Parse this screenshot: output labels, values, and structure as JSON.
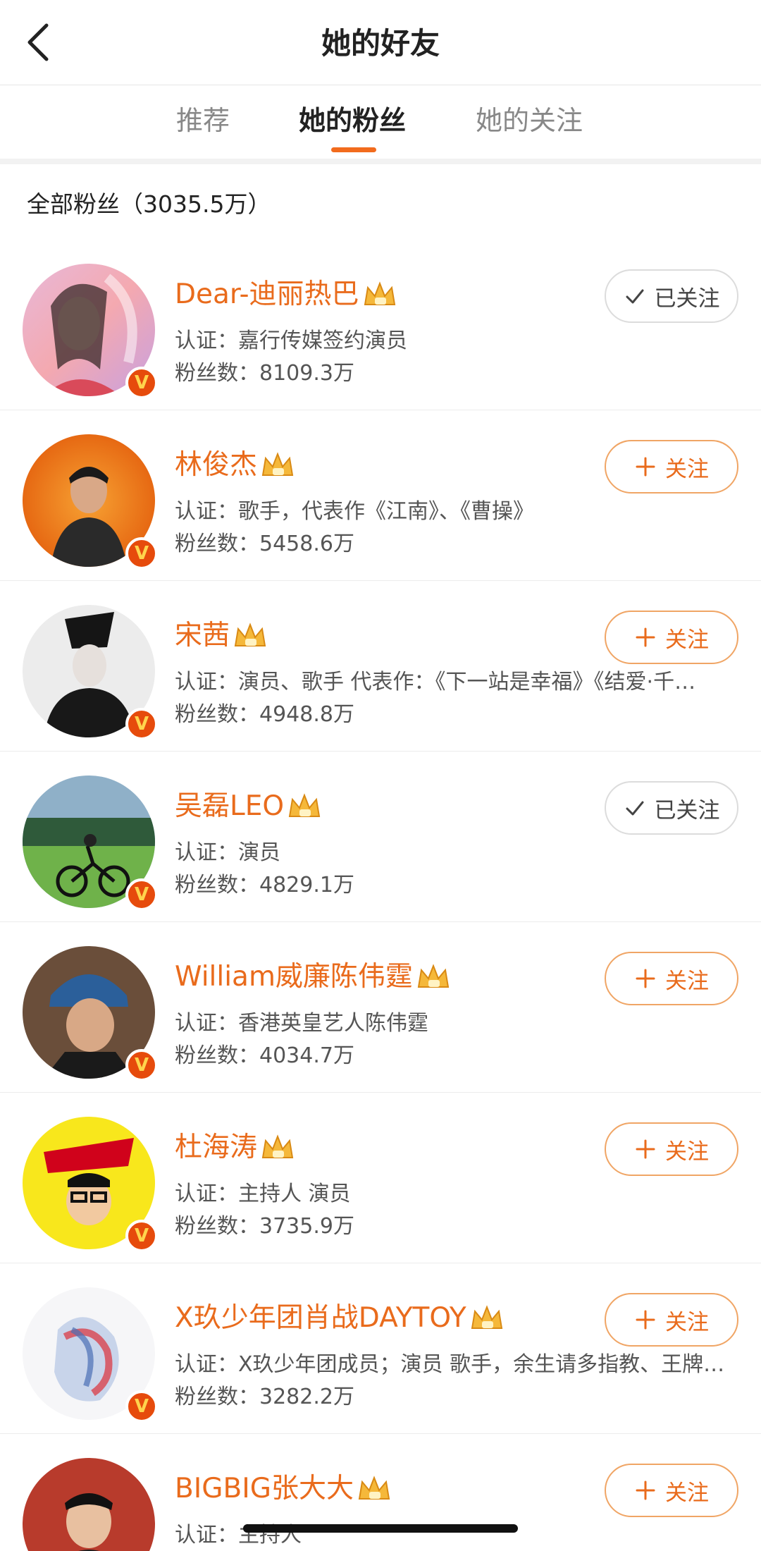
{
  "header": {
    "title": "她的好友"
  },
  "tabs": [
    {
      "label": "推荐"
    },
    {
      "label": "她的粉丝",
      "active": true
    },
    {
      "label": "她的关注"
    }
  ],
  "section": {
    "title": "全部粉丝（3035.5万）"
  },
  "colors": {
    "accent": "#e96b1c",
    "indicator": "#f26b1d",
    "verified_badge": "#e64b0c"
  },
  "users": [
    {
      "name": "Dear-迪丽热巴",
      "info": "认证：嘉行传媒签约演员",
      "fans": "粉丝数：8109.3万",
      "button": "已关注",
      "followed": true
    },
    {
      "name": "林俊杰",
      "info": "认证：歌手，代表作《江南》、《曹操》",
      "fans": "粉丝数：5458.6万",
      "button": "关注",
      "followed": false
    },
    {
      "name": "宋茜",
      "info": "认证：演员、歌手 代表作：《下一站是幸福》《结爱·千…",
      "fans": "粉丝数：4948.8万",
      "button": "关注",
      "followed": false
    },
    {
      "name": "吴磊LEO",
      "info": "认证：演员",
      "fans": "粉丝数：4829.1万",
      "button": "已关注",
      "followed": true
    },
    {
      "name": "William威廉陈伟霆",
      "info": "认证：香港英皇艺人陈伟霆",
      "fans": "粉丝数：4034.7万",
      "button": "关注",
      "followed": false
    },
    {
      "name": "杜海涛",
      "info": "认证：主持人 演员",
      "fans": "粉丝数：3735.9万",
      "button": "关注",
      "followed": false
    },
    {
      "name": "X玖少年团肖战DAYTOY",
      "info": "认证：X玖少年团成员；演员 歌手，余生请多指教、王牌…",
      "fans": "粉丝数：3282.2万",
      "button": "关注",
      "followed": false
    },
    {
      "name": "BIGBIG张大大",
      "info": "认证：主持人",
      "fans": "",
      "button": "关注",
      "followed": false
    }
  ]
}
